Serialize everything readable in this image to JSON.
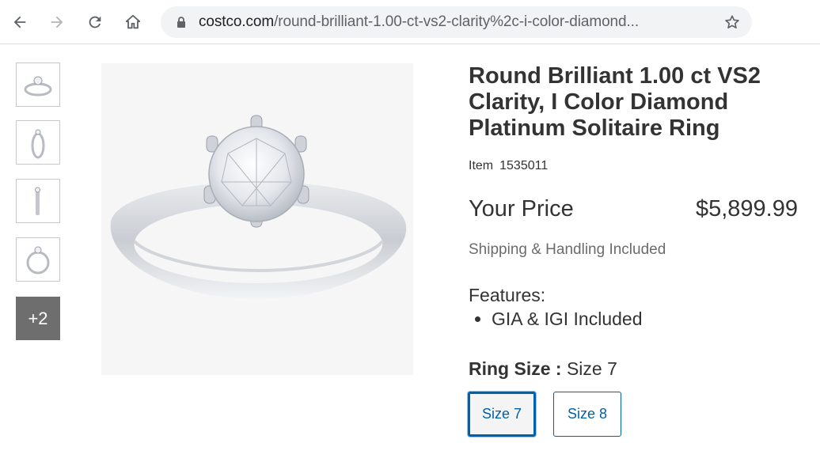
{
  "browser": {
    "url_domain": "costco.com",
    "url_path": "/round-brilliant-1.00-ct-vs2-clarity%2c-i-color-diamond..."
  },
  "thumbnails": {
    "more_label": "+2"
  },
  "product": {
    "title": "Round Brilliant 1.00 ct VS2 Clarity, I Color Diamond Platinum Solitaire Ring",
    "item_label": "Item",
    "item_number": "1535011",
    "price_label": "Your Price",
    "price_value": "$5,899.99",
    "shipping": "Shipping & Handling Included",
    "features_title": "Features:",
    "features": [
      "GIA & IGI Included"
    ],
    "ring_size_label": "Ring Size :",
    "ring_size_value": "Size 7",
    "size_options": [
      "Size 7",
      "Size 8"
    ]
  },
  "colors": {
    "accent": "#0060a9",
    "more_tile": "#6e6e6e"
  }
}
